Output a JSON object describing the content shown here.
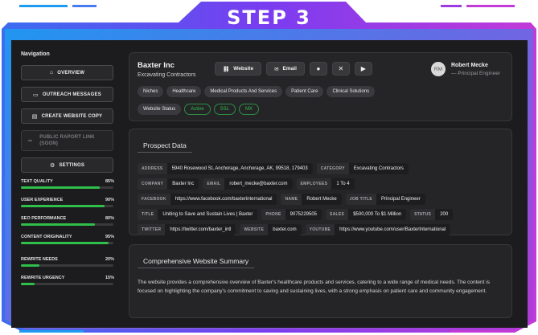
{
  "header": {
    "step_title": "STEP 3"
  },
  "sidebar": {
    "heading": "Navigation",
    "buttons": [
      {
        "label": "OVERVIEW",
        "icon": "home-icon"
      },
      {
        "label": "OUTREACH MESSAGES",
        "icon": "message-icon"
      },
      {
        "label": "CREATE WEBSITE COPY",
        "icon": "document-icon"
      },
      {
        "label": "PUBLIC RAPORT LINK (SOON)",
        "icon": "link-icon"
      },
      {
        "label": "SETTINGS",
        "icon": "gear-icon"
      }
    ],
    "metrics": [
      {
        "label": "TEXT QUALITY",
        "value": "85%",
        "fraction": 0.85
      },
      {
        "label": "USER EXPERIENCE",
        "value": "90%",
        "fraction": 0.9
      },
      {
        "label": "SEO PERFORMANCE",
        "value": "80%",
        "fraction": 0.8
      },
      {
        "label": "CONTENT ORIGINALITY",
        "value": "95%",
        "fraction": 0.95
      },
      {
        "label": "REWRITE NEEDS",
        "value": "20%",
        "fraction": 0.2
      },
      {
        "label": "REWRITE URGENCY",
        "value": "15%",
        "fraction": 0.15
      }
    ],
    "bar_color": "#2fbf4a"
  },
  "profile": {
    "company": "Baxter Inc",
    "subtitle": "Excavating Contractors",
    "website_label": "Website",
    "email_label": "Email",
    "social_icons": [
      "facebook-icon",
      "x-icon",
      "youtube-icon"
    ],
    "person": {
      "initials": "RM",
      "name": "Robert Mecke",
      "role": "— Principal Engineer"
    },
    "niches_label": "Niches",
    "niches": [
      "Healthcare",
      "Medical Products And Services",
      "Patient Care",
      "Clinical Solutions"
    ],
    "status_label": "Website Status",
    "statuses": [
      "Active",
      "SSL",
      "MX"
    ]
  },
  "prospect": {
    "title": "Prospect Data",
    "rows": [
      [
        {
          "k": "ADDRESS",
          "v": "5940 Rosewood St, Anchorage, Anchorage, AK, 99518, 179403"
        },
        {
          "k": "CATEGORY",
          "v": "Excavating Contractors"
        }
      ],
      [
        {
          "k": "COMPANY",
          "v": "Baxter Inc"
        },
        {
          "k": "EMAIL",
          "v": "robert_mecke@baxter.com"
        },
        {
          "k": "EMPLOYEES",
          "v": "1 To 4"
        }
      ],
      [
        {
          "k": "FACEBOOK",
          "v": "https://www.facebook.com/baxterinternational"
        },
        {
          "k": "NAME",
          "v": "Robert Mecke"
        },
        {
          "k": "JOB TITLE",
          "v": "Principal Engineer"
        }
      ],
      [
        {
          "k": "TITLE",
          "v": "Uniting to Save and Sustain Lives | Baxter"
        },
        {
          "k": "PHONE",
          "v": "9075229505"
        },
        {
          "k": "SALES",
          "v": "$500,000 To $1 Million"
        },
        {
          "k": "STATUS",
          "v": "200"
        }
      ],
      [
        {
          "k": "TWITTER",
          "v": "https://twitter.com/baxter_intl"
        },
        {
          "k": "WEBSITE",
          "v": "baxter.com"
        },
        {
          "k": "YOUTUBE",
          "v": "https://www.youtube.com/user/BaxterInternational"
        }
      ]
    ]
  },
  "summary": {
    "title": "Comprehensive Website Summary",
    "text": "The website provides a comprehensive overview of Baxter's healthcare products and services, catering to a wide range of medical needs. The content is focused on highlighting the company's commitment to saving and sustaining lives, with a strong emphasis on patient care and community engagement."
  }
}
